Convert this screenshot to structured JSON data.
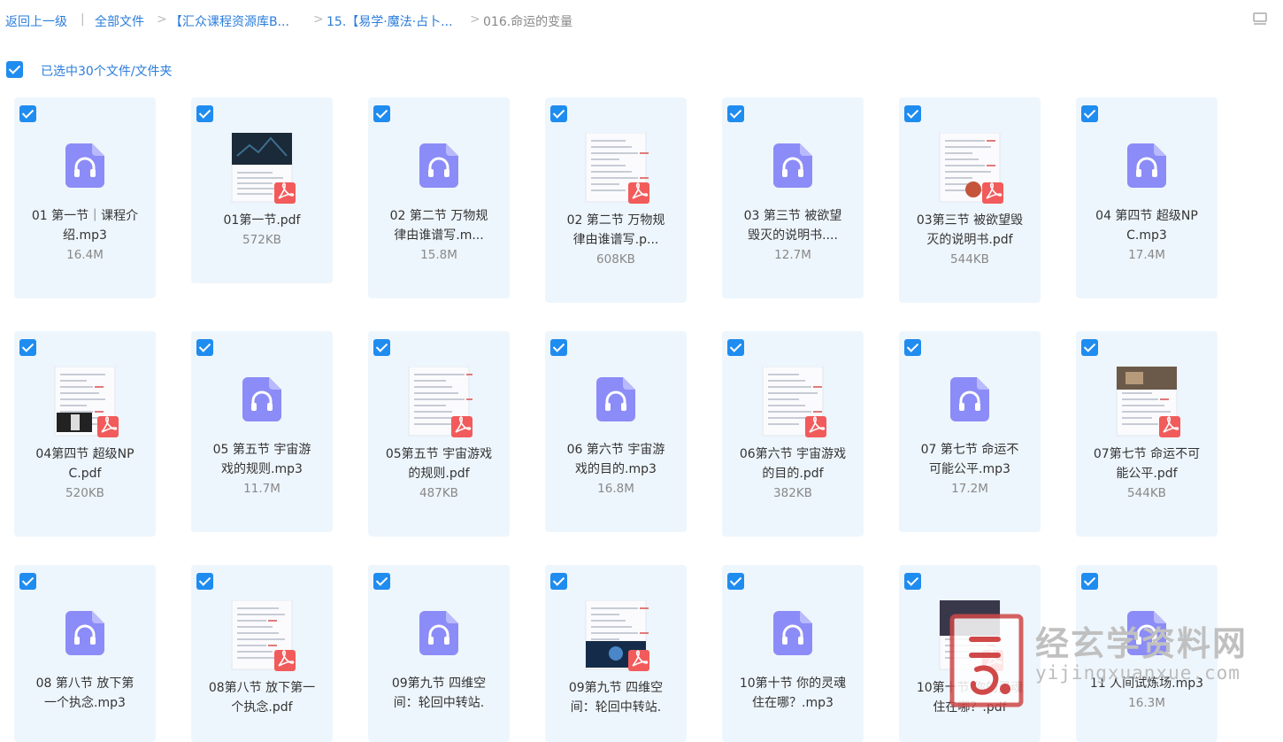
{
  "breadcrumb": {
    "back": "返回上一级",
    "divider": "|",
    "items": [
      "全部文件",
      "【汇众课程资源库B...",
      "15.【易学·魔法·占卜...",
      "016.命运的变量"
    ],
    "chevron": ">"
  },
  "selection": {
    "label": "已选中30个文件/文件夹"
  },
  "colors": {
    "accent": "#1f8cf0",
    "card_bg": "#eef6fd",
    "audio_icon": "#8b8cf7",
    "pdf_badge": "#f25b5b"
  },
  "files": [
    {
      "name": "01 第一节｜课程介绍.mp3",
      "l1": "01 第一节｜课程介",
      "l2": "绍.mp3",
      "size": "16.4M",
      "type": "audio"
    },
    {
      "name": "01第一节.pdf",
      "l1": "01第一节.pdf",
      "l2": "",
      "size": "572KB",
      "type": "pdf"
    },
    {
      "name": "02 第二节 万物规律由谁谱写.m...",
      "l1": "02 第二节 万物规",
      "l2": "律由谁谱写.m...",
      "size": "15.8M",
      "type": "audio"
    },
    {
      "name": "02 第二节 万物规律由谁谱写.p...",
      "l1": "02 第二节 万物规",
      "l2": "律由谁谱写.p...",
      "size": "608KB",
      "type": "pdf"
    },
    {
      "name": "03 第三节 被欲望毁灭的说明书....",
      "l1": "03 第三节 被欲望",
      "l2": "毁灭的说明书....",
      "size": "12.7M",
      "type": "audio"
    },
    {
      "name": "03第三节 被欲望毁灭的说明书.pdf",
      "l1": "03第三节 被欲望毁",
      "l2": "灭的说明书.pdf",
      "size": "544KB",
      "type": "pdf"
    },
    {
      "name": "04 第四节 超级NPC.mp3",
      "l1": "04 第四节 超级NP",
      "l2": "C.mp3",
      "size": "17.4M",
      "type": "audio"
    },
    {
      "name": "04第四节 超级NPC.pdf",
      "l1": "04第四节 超级NP",
      "l2": "C.pdf",
      "size": "520KB",
      "type": "pdf"
    },
    {
      "name": "05 第五节 宇宙游戏的规则.mp3",
      "l1": "05 第五节 宇宙游",
      "l2": "戏的规则.mp3",
      "size": "11.7M",
      "type": "audio"
    },
    {
      "name": "05第五节 宇宙游戏的规则.pdf",
      "l1": "05第五节 宇宙游戏",
      "l2": "的规则.pdf",
      "size": "487KB",
      "type": "pdf"
    },
    {
      "name": "06 第六节 宇宙游戏的目的.mp3",
      "l1": "06 第六节 宇宙游",
      "l2": "戏的目的.mp3",
      "size": "16.8M",
      "type": "audio"
    },
    {
      "name": "06第六节 宇宙游戏的目的.pdf",
      "l1": "06第六节 宇宙游戏",
      "l2": "的目的.pdf",
      "size": "382KB",
      "type": "pdf"
    },
    {
      "name": "07 第七节 命运不可能公平.mp3",
      "l1": "07 第七节 命运不",
      "l2": "可能公平.mp3",
      "size": "17.2M",
      "type": "audio"
    },
    {
      "name": "07第七节 命运不可能公平.pdf",
      "l1": "07第七节 命运不可",
      "l2": "能公平.pdf",
      "size": "544KB",
      "type": "pdf"
    },
    {
      "name": "08 第八节 放下第一个执念.mp3",
      "l1": "08 第八节 放下第",
      "l2": "一个执念.mp3",
      "size": "",
      "type": "audio"
    },
    {
      "name": "08第八节 放下第一个执念.pdf",
      "l1": "08第八节 放下第一",
      "l2": "个执念.pdf",
      "size": "",
      "type": "pdf"
    },
    {
      "name": "09第九节 四维空间：轮回中转站.",
      "l1": "09第九节 四维空",
      "l2": "间：轮回中转站.",
      "size": "",
      "type": "audio"
    },
    {
      "name": "09第九节 四维空间：轮回中转站.",
      "l1": "09第九节 四维空",
      "l2": "间：轮回中转站.",
      "size": "",
      "type": "pdf"
    },
    {
      "name": "10第十节 你的灵魂住在哪？.mp3",
      "l1": "10第十节 你的灵魂",
      "l2": "住在哪？.mp3",
      "size": "",
      "type": "audio"
    },
    {
      "name": "10第十节 你的灵魂住在哪？.pdf",
      "l1": "10第十节 你的灵魂",
      "l2": "住在哪？.pdf",
      "size": "",
      "type": "pdf"
    },
    {
      "name": "11 人间试炼场.mp3",
      "l1": "11 人间试炼场.mp3",
      "l2": "",
      "size": "16.3M",
      "type": "audio"
    }
  ],
  "watermark": {
    "title": "经玄学资料网",
    "url": "yijingxuanxue.com"
  }
}
